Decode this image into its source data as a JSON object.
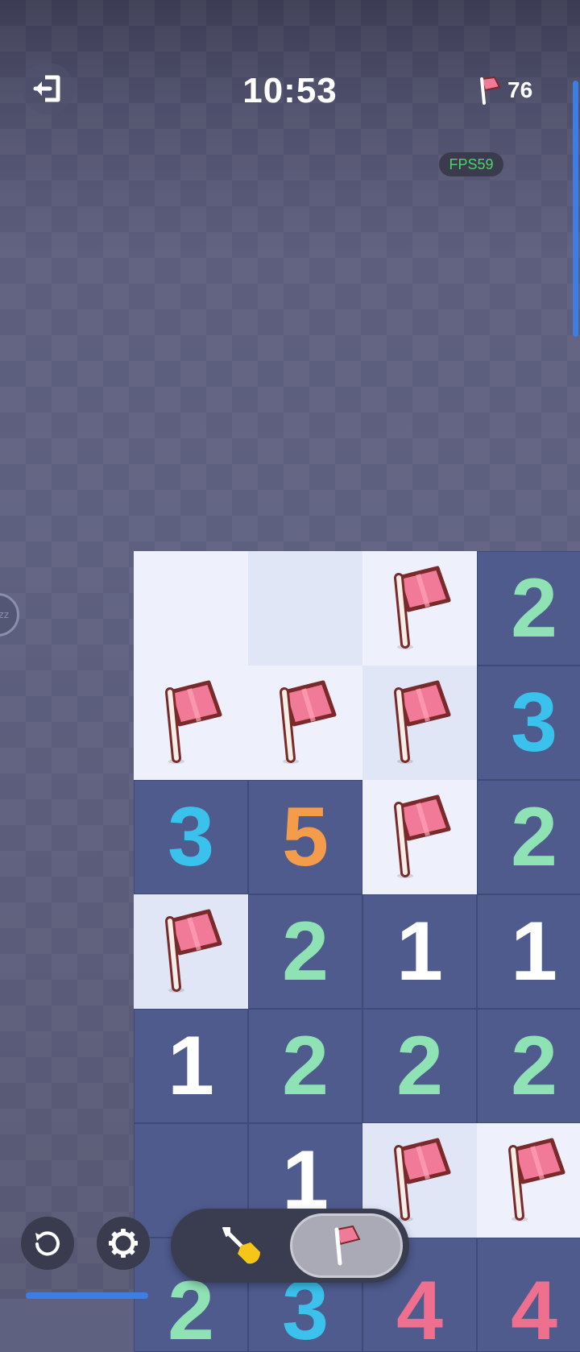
{
  "header": {
    "timer": "10:53",
    "flags_remaining": "76",
    "fps": "FPS59",
    "exit_icon": "exit-icon",
    "flag_icon": "flag-icon"
  },
  "side_indicator": {
    "label": "zz"
  },
  "board": {
    "rows": [
      [
        {
          "state": "closed-a",
          "flag": false,
          "num": ""
        },
        {
          "state": "closed-b",
          "flag": false,
          "num": ""
        },
        {
          "state": "closed-a",
          "flag": true,
          "num": ""
        },
        {
          "state": "open",
          "flag": false,
          "num": "2"
        }
      ],
      [
        {
          "state": "closed-a",
          "flag": true,
          "num": ""
        },
        {
          "state": "closed-a",
          "flag": true,
          "num": ""
        },
        {
          "state": "closed-b",
          "flag": true,
          "num": ""
        },
        {
          "state": "open",
          "flag": false,
          "num": "3"
        }
      ],
      [
        {
          "state": "open",
          "flag": false,
          "num": "3"
        },
        {
          "state": "open",
          "flag": false,
          "num": "5"
        },
        {
          "state": "closed-a",
          "flag": true,
          "num": ""
        },
        {
          "state": "open",
          "flag": false,
          "num": "2"
        }
      ],
      [
        {
          "state": "closed-b",
          "flag": true,
          "num": ""
        },
        {
          "state": "open",
          "flag": false,
          "num": "2"
        },
        {
          "state": "open",
          "flag": false,
          "num": "1"
        },
        {
          "state": "open",
          "flag": false,
          "num": "1"
        }
      ],
      [
        {
          "state": "open",
          "flag": false,
          "num": "1"
        },
        {
          "state": "open",
          "flag": false,
          "num": "2"
        },
        {
          "state": "open",
          "flag": false,
          "num": "2"
        },
        {
          "state": "open",
          "flag": false,
          "num": "2"
        }
      ],
      [
        {
          "state": "open",
          "flag": false,
          "num": ""
        },
        {
          "state": "open",
          "flag": false,
          "num": "1"
        },
        {
          "state": "closed-b",
          "flag": true,
          "num": ""
        },
        {
          "state": "closed-a",
          "flag": true,
          "num": ""
        }
      ]
    ],
    "partial_row": [
      {
        "state": "open",
        "flag": false,
        "num": "2"
      },
      {
        "state": "open",
        "flag": false,
        "num": "3"
      },
      {
        "state": "open",
        "flag": false,
        "num": "4"
      },
      {
        "state": "open",
        "flag": false,
        "num": "4"
      }
    ]
  },
  "controls": {
    "restart_icon": "restart-icon",
    "settings_icon": "gear-icon",
    "dig_icon": "shovel-icon",
    "flag_mode_icon": "flag-icon",
    "active_mode": "flag"
  },
  "colors": {
    "open_cell": "#4f5b8d",
    "closed_cell_light": "#eef0fb",
    "closed_cell_alt": "#e1e6f7",
    "n1": "#ffffff",
    "n2": "#8ee2b4",
    "n3": "#3ac2ec",
    "n4": "#ef6f8e",
    "n5": "#f49c4a",
    "flag": "#f07a98",
    "accent": "#3d7ee5"
  }
}
